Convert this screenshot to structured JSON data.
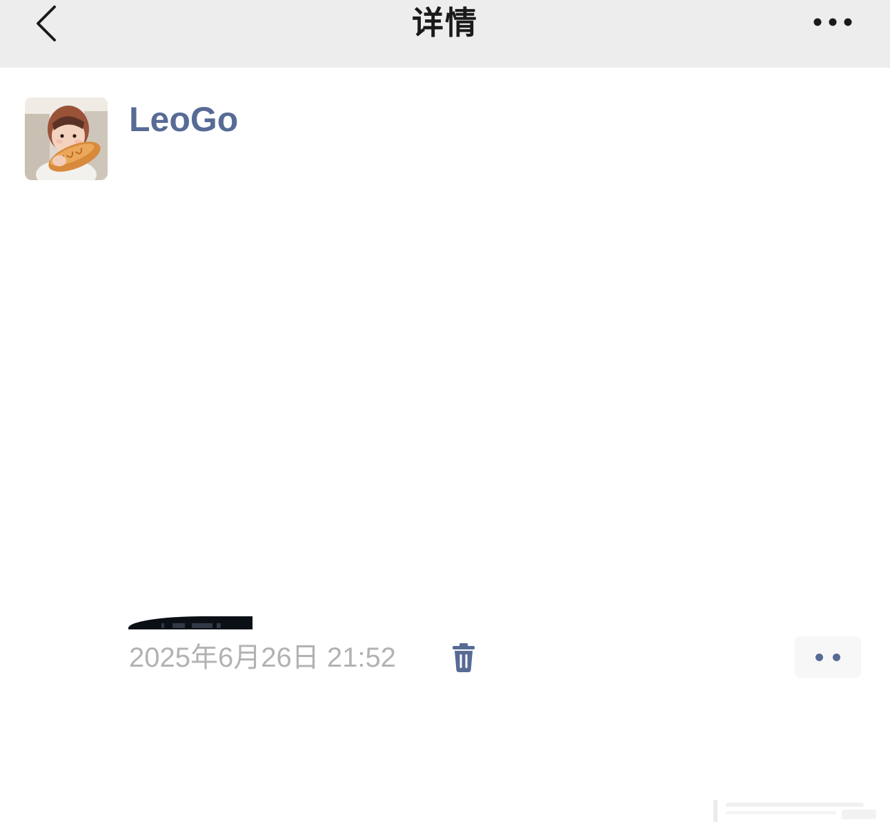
{
  "nav": {
    "title": "详情",
    "back_icon": "chevron-left-icon",
    "more_icon": "more-horizontal-icon"
  },
  "post": {
    "author": "LeoGo",
    "avatar_icon": "baby-eating-bread-avatar",
    "timestamp": "2025年6月26日 21:52",
    "delete_icon": "trash-icon",
    "actions_icon": "two-dots-icon"
  },
  "colors": {
    "nav_background": "#ededed",
    "nickname": "#576b95",
    "timestamp_text": "#b2b2b2",
    "icon_accent": "#576b95",
    "action_button_bg": "#f7f7f7"
  }
}
